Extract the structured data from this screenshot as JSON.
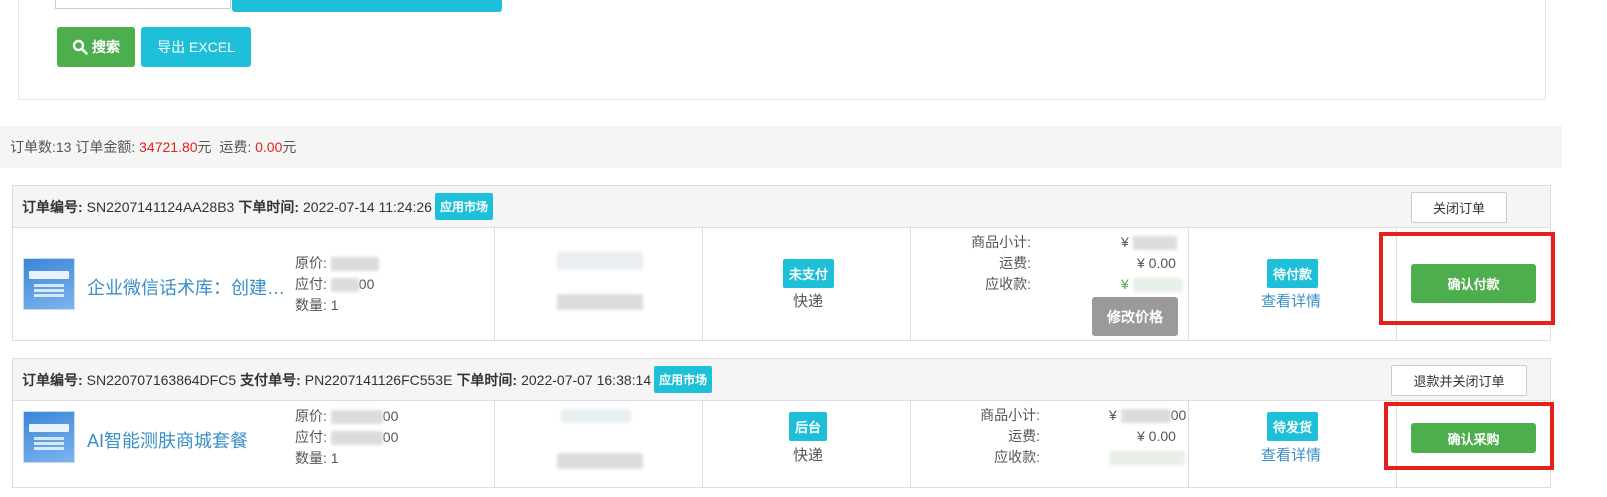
{
  "toolbar": {
    "search_label": "搜索",
    "export_label": "导出 EXCEL"
  },
  "summary": {
    "count_label": "订单数: ",
    "count": "13",
    "amount_label": " 订单金额: ",
    "amount": "34721.80",
    "amount_unit": "元",
    "freight_label": "  运费: ",
    "freight": "0.00",
    "freight_unit": "元"
  },
  "orders": [
    {
      "no_label": "订单编号:",
      "no": "SN2207141124AA28B3",
      "time_label": "下单时间:",
      "time": "2022-07-14 11:24:26",
      "source_tag": "应用市场",
      "close_label": "关闭订单",
      "product_name": "企业微信话术库：创建…",
      "orig_label": "原价:",
      "pay_label": "应付:",
      "pay_tail": "00",
      "qty_label": "数量:",
      "qty": "1",
      "pay_status": "未支付",
      "ship_method": "快递",
      "subtotal_label": "商品小计:",
      "subtotal_prefix": "¥",
      "freight_label": "运费:",
      "freight": "¥ 0.00",
      "receivable_label": "应收款:",
      "receivable_prefix": "¥",
      "modify_price_label": "修改价格",
      "order_status": "待付款",
      "detail_link": "查看详情",
      "action_label": "确认付款"
    },
    {
      "no_label": "订单编号:",
      "no": "SN220707163864DFC5",
      "pay_no_label": "支付单号:",
      "pay_no": "PN2207141126FC553E",
      "time_label": "下单时间:",
      "time": "2022-07-07 16:38:14",
      "source_tag": "应用市场",
      "close_label": "退款并关闭订单",
      "product_name": "AI智能测肤商城套餐",
      "orig_label": "原价:",
      "orig_tail": "00",
      "pay_label": "应付:",
      "pay_tail": "00",
      "qty_label": "数量:",
      "qty": "1",
      "pay_status": "后台",
      "ship_method": "快递",
      "subtotal_label": "商品小计:",
      "subtotal_prefix": "¥",
      "subtotal_tail": "00",
      "freight_label": "运费:",
      "freight": "¥ 0.00",
      "receivable_label": "应收款:",
      "order_status": "待发货",
      "detail_link": "查看详情",
      "action_label": "确认采购"
    }
  ],
  "colors": {
    "accent_teal": "#1ebfd8",
    "green": "#4cae4c",
    "red": "#e5211c",
    "link": "#3a8fc8"
  }
}
